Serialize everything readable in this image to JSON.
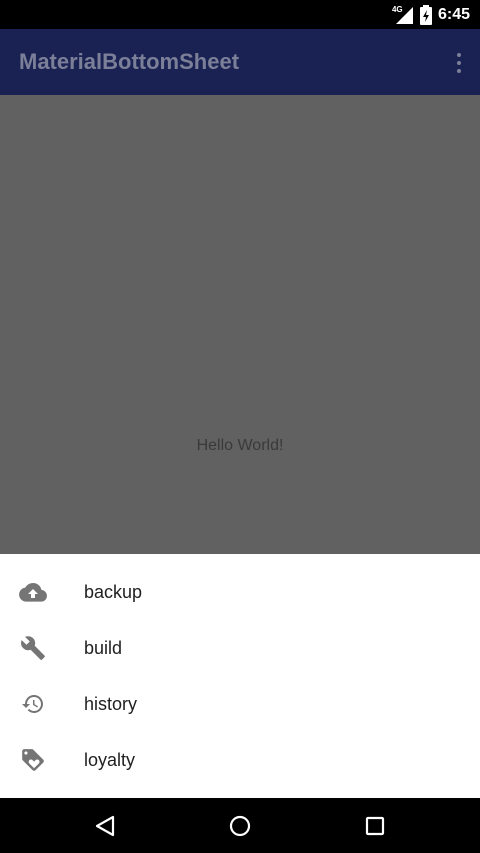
{
  "status_bar": {
    "network": "4G",
    "time": "6:45"
  },
  "app_bar": {
    "title": "MaterialBottomSheet",
    "overflow_icon": "more-vert-icon"
  },
  "content": {
    "text": "Hello World!"
  },
  "bottom_sheet": {
    "items": [
      {
        "label": "backup",
        "icon": "cloud-upload-icon"
      },
      {
        "label": "build",
        "icon": "wrench-icon"
      },
      {
        "label": "history",
        "icon": "history-icon"
      },
      {
        "label": "loyalty",
        "icon": "loyalty-tag-icon"
      }
    ]
  },
  "nav_bar": {
    "buttons": [
      "back-icon",
      "home-icon",
      "recents-icon"
    ]
  },
  "colors": {
    "primary_dark": "#1a2254",
    "scrim": "#616161",
    "sheet_bg": "#ffffff",
    "icon_gray": "#757575"
  }
}
